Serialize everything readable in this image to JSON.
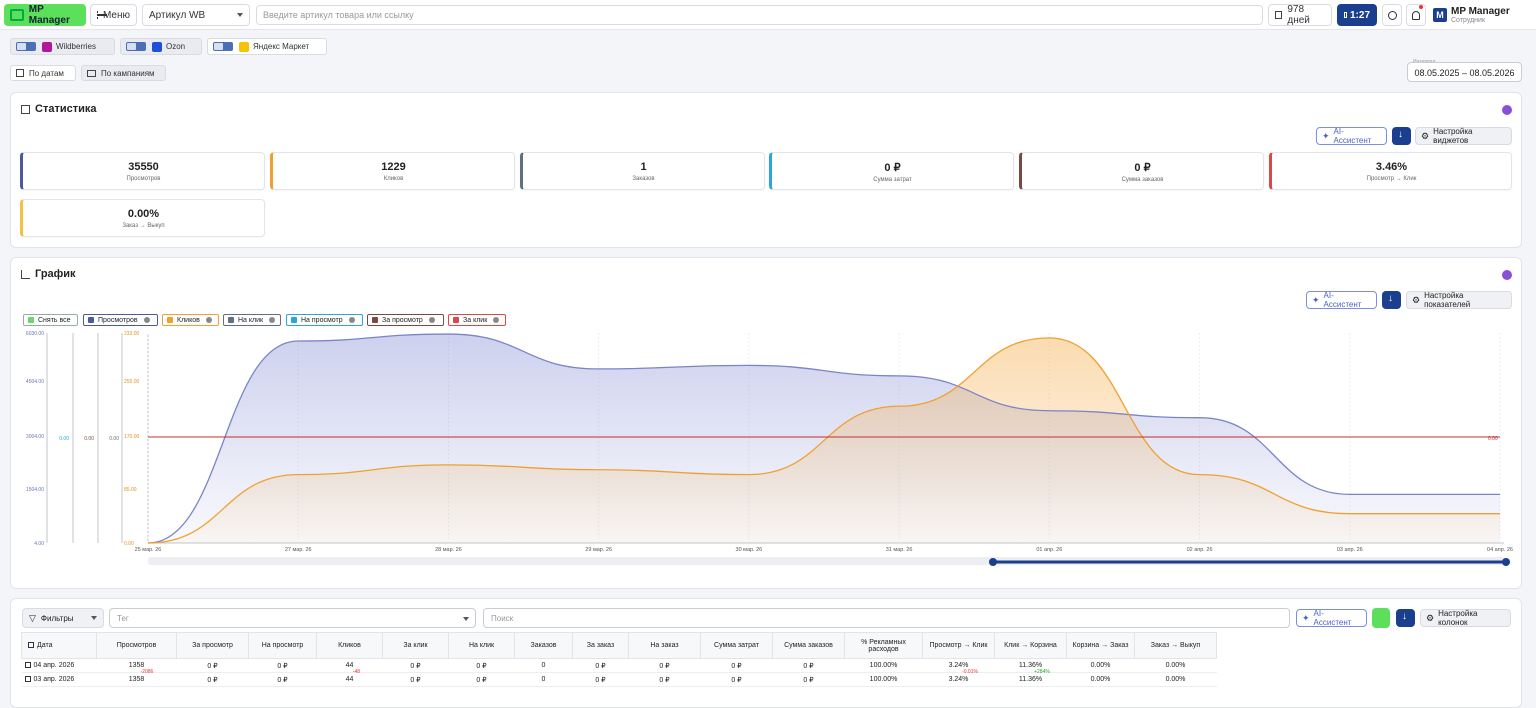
{
  "topbar": {
    "logo": "MP Manager",
    "menu": "Меню",
    "article_select": "Артикул WB",
    "search_placeholder": "Введите артикул товара или ссылку",
    "days": "978 дней",
    "timer": "1:27",
    "user_name": "MP Manager",
    "user_role": "Сотрудник"
  },
  "marketplaces": [
    {
      "name": "Wildberries",
      "color": "#b0179a"
    },
    {
      "name": "Ozon",
      "color": "#1e4fd8"
    },
    {
      "name": "Яндекс Маркет",
      "color": "#f5c400"
    }
  ],
  "view_tabs": {
    "by_dates": "По датам",
    "by_campaigns": "По кампаниям"
  },
  "period": {
    "label": "Интервал",
    "value": "08.05.2025 – 08.05.2026"
  },
  "stats": {
    "title": "Статистика",
    "ai_button": "AI-Ассистент",
    "settings_button": "Настройка виджетов",
    "cards": [
      {
        "value": "35550",
        "label": "Просмотров",
        "color": "#4a5a9c"
      },
      {
        "value": "1229",
        "label": "Кликов",
        "color": "#f0a030"
      },
      {
        "value": "1",
        "label": "Заказов",
        "color": "#607080"
      },
      {
        "value": "0 ₽",
        "label": "Сумма затрат",
        "color": "#2aa6d8"
      },
      {
        "value": "0 ₽",
        "label": "Сумма заказов",
        "color": "#7a4a40"
      },
      {
        "value": "3.46%",
        "label": "Просмотр → Клик",
        "color": "#d84a4a"
      },
      {
        "value": "0.00%",
        "label": "Заказ → Выкуп",
        "color": "#f5c040"
      }
    ]
  },
  "graph": {
    "title": "График",
    "ai_button": "AI-Ассистент",
    "settings_button": "Настройка показателей",
    "legend": [
      {
        "label": "Снять все",
        "color": "#6bd46b",
        "closable": false
      },
      {
        "label": "Просмотров",
        "color": "#4a5a9c",
        "closable": true
      },
      {
        "label": "Кликов",
        "color": "#f0a030",
        "closable": true
      },
      {
        "label": "На клик",
        "color": "#607080",
        "closable": true
      },
      {
        "label": "На просмотр",
        "color": "#2aa6d8",
        "closable": true
      },
      {
        "label": "За просмотр",
        "color": "#7a4a40",
        "closable": true
      },
      {
        "label": "За клик",
        "color": "#d84a4a",
        "closable": true
      }
    ]
  },
  "chart_data": {
    "type": "area",
    "x": [
      "25 мар. 26",
      "27 мар. 26",
      "28 мар. 26",
      "29 мар. 26",
      "30 мар. 26",
      "31 мар. 26",
      "01 апр. 26",
      "02 апр. 26",
      "03 апр. 26",
      "04 апр. 26"
    ],
    "y_ticks_views": [
      "6030.00",
      "4504.00",
      "3004.00",
      "1504.00",
      "4.00"
    ],
    "y_ticks_clicks": [
      "233.00",
      "255.00",
      "170.00",
      "85.00",
      "0.00"
    ],
    "y_ticks_small_a": "0.00",
    "y_ticks_small_b": "0.00",
    "y_ticks_small_c": "0.00",
    "right_tick": "0.00",
    "series": [
      {
        "name": "Просмотров",
        "color": "#7b84c8",
        "values": [
          4,
          5800,
          6000,
          5000,
          5100,
          4800,
          3800,
          3600,
          1400,
          1400
        ]
      },
      {
        "name": "Кликов",
        "color": "#f0a030",
        "values": [
          0,
          70,
          80,
          75,
          70,
          140,
          210,
          70,
          30,
          30
        ]
      },
      {
        "name": "За клик",
        "color": "#c03030",
        "values": [
          0,
          0,
          0,
          0,
          0,
          0,
          0,
          0,
          0,
          0
        ]
      }
    ]
  },
  "filters": {
    "filter_button": "Фильтры",
    "tag_placeholder": "Тег",
    "search_placeholder": "Поиск",
    "ai_button": "AI-Ассистент",
    "columns_button": "Настройка колонок"
  },
  "table": {
    "headers": [
      "Дата",
      "Просмотров",
      "За просмотр",
      "На просмотр",
      "Кликов",
      "За клик",
      "На клик",
      "Заказов",
      "За заказ",
      "На заказ",
      "Сумма затрат",
      "Сумма заказов",
      "% Рекламных расходов",
      "Просмотр → Клик",
      "Клик → Корзина",
      "Корзина → Заказ",
      "Заказ → Выкуп"
    ],
    "rows": [
      [
        "04 апр. 2026",
        "1358",
        "0 ₽",
        "0 ₽",
        "44",
        "0 ₽",
        "0 ₽",
        "0",
        "0 ₽",
        "0 ₽",
        "0 ₽",
        "0 ₽",
        "100.00%",
        "3.24%",
        "11.36%",
        "0.00%",
        "0.00%"
      ],
      [
        "03 апр. 2026",
        "1358",
        "0 ₽",
        "0 ₽",
        "44",
        "0 ₽",
        "0 ₽",
        "0",
        "0 ₽",
        "0 ₽",
        "0 ₽",
        "0 ₽",
        "100.00%",
        "3.24%",
        "11.36%",
        "0.00%",
        "0.00%"
      ]
    ],
    "deltas": {
      "views": "-2086",
      "clicks": "-48",
      "view_click": "-0.01%",
      "click_cart": "+284%"
    }
  }
}
